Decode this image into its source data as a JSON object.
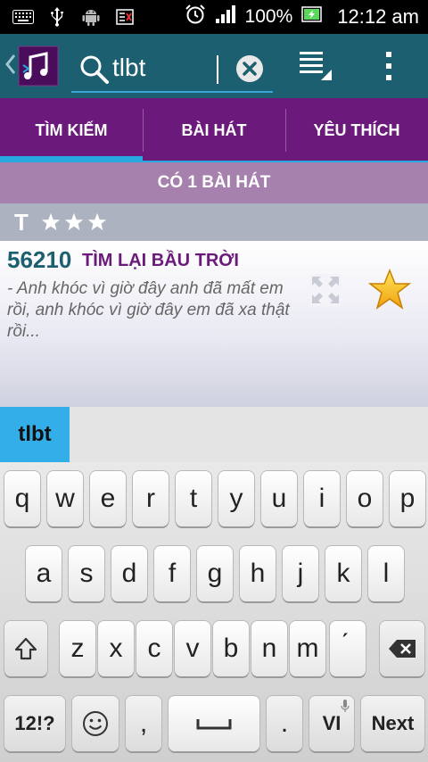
{
  "status_bar": {
    "battery": "100%",
    "time": "12:12 am"
  },
  "search": {
    "query": "tlbt"
  },
  "tabs": [
    {
      "label": "TÌM KIẾM",
      "active": true
    },
    {
      "label": "BÀI HÁT",
      "active": false
    },
    {
      "label": "YÊU THÍCH",
      "active": false
    }
  ],
  "results": {
    "count_label": "CÓ 1 BÀI HÁT"
  },
  "section": {
    "letter": "T",
    "stars": 3
  },
  "songs": [
    {
      "code": "56210",
      "title": "TÌM LẠI BẦU TRỜI",
      "lyric": "- Anh khóc vì giờ đây anh đã mất em rồi, anh khóc vì giờ đây em đã xa thật rồi...",
      "favorite": true
    }
  ],
  "suggestion": {
    "text": "tlbt"
  },
  "keyboard": {
    "row1": [
      "q",
      "w",
      "e",
      "r",
      "t",
      "y",
      "u",
      "i",
      "o",
      "p"
    ],
    "row2": [
      "a",
      "s",
      "d",
      "f",
      "g",
      "h",
      "j",
      "k",
      "l"
    ],
    "row3": [
      "z",
      "x",
      "c",
      "v",
      "b",
      "n",
      "m",
      "́"
    ],
    "symbols_label": "12!?",
    "comma_label": ",",
    "period_label": ".",
    "lang_label": "VI",
    "next_label": "Next"
  },
  "colors": {
    "action_bar": "#1c5f70",
    "tabs": "#6b1a7b",
    "accent": "#28a8e0",
    "count_bar": "#a681ad"
  }
}
